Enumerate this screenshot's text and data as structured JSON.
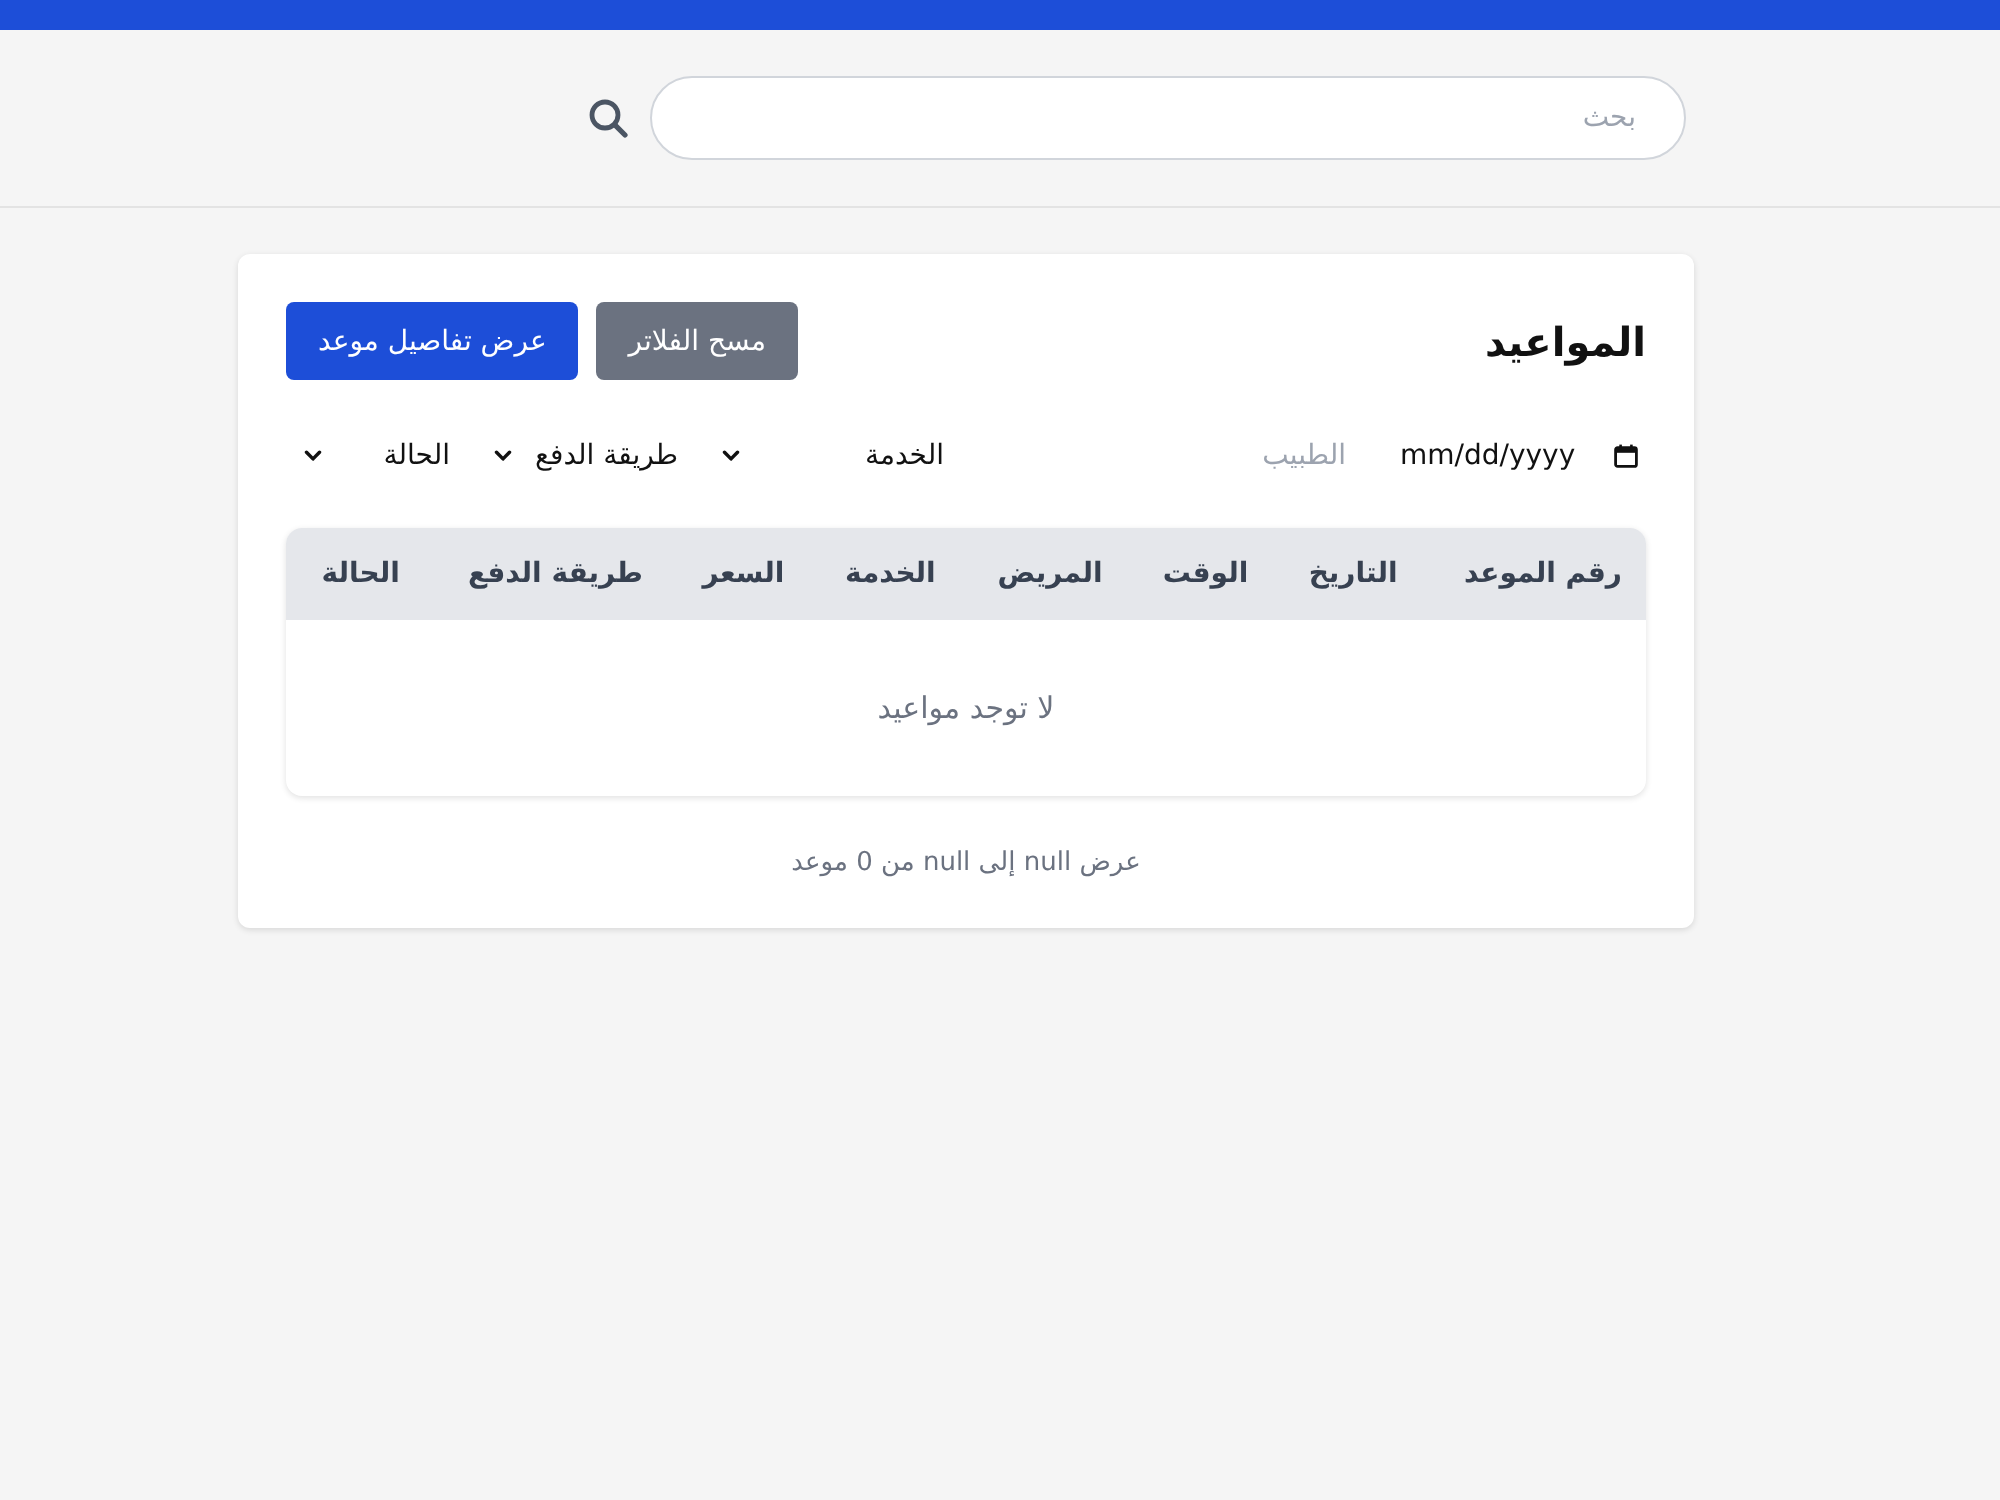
{
  "header": {
    "search": {
      "placeholder": "بحث"
    }
  },
  "appointments": {
    "title": "المواعيد",
    "buttons": [
      {
        "label": "مسح الفلاتر",
        "kind": "secondary"
      },
      {
        "label": "عرض تفاصيل موعد",
        "kind": "primary"
      }
    ],
    "filters": [
      {
        "kind": "date",
        "placeholder": "mm/dd/yyyy"
      },
      {
        "kind": "text",
        "placeholder": "الطبيب"
      },
      {
        "kind": "select",
        "value": "الخدمة"
      },
      {
        "kind": "select",
        "value": "طريقة الدفع"
      },
      {
        "kind": "select",
        "value": "الحالة"
      }
    ],
    "table": {
      "columns": [
        "رقم الموعد",
        "التاريخ",
        "الوقت",
        "المريض",
        "الخدمة",
        "السعر",
        "طريقة الدفع",
        "الحالة"
      ],
      "empty_message": "لا توجد مواعيد"
    },
    "summary": "عرض null إلى null من 0 موعد"
  }
}
